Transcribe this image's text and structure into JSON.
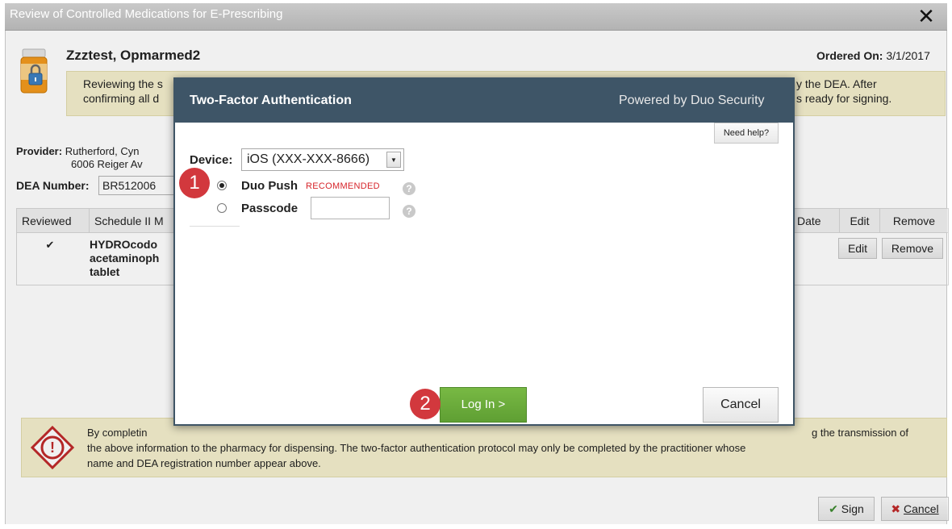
{
  "window": {
    "title": "Review of Controlled Medications for E-Prescribing",
    "close_glyph": "✕"
  },
  "patient": {
    "name": "Zzztest, Opmarmed2",
    "ordered_label": "Ordered On:",
    "ordered_value": "3/1/2017"
  },
  "notice_top": {
    "line1_left": "Reviewing the s",
    "line1_right": "y the DEA. After",
    "line2_left": "confirming all d",
    "line2_right": "s ready for signing."
  },
  "provider": {
    "label": "Provider:",
    "name": "Rutherford, Cyn",
    "address": "6006 Reiger Av",
    "dea_label": "DEA Number:",
    "dea_value": "BR512006"
  },
  "table": {
    "headers": {
      "reviewed": "Reviewed",
      "schedule": "Schedule II M",
      "date": "Date",
      "edit": "Edit",
      "remove": "Remove"
    },
    "row": {
      "check": "✔",
      "med_line1": "HYDROcodo",
      "med_line2": "acetaminoph",
      "med_line3": "tablet",
      "edit_label": "Edit",
      "remove_label": "Remove"
    }
  },
  "notice_bottom": {
    "line1_left": "By completin",
    "line1_right": "g the transmission of",
    "line2": "the above information to the pharmacy for dispensing. The two-factor authentication protocol may only be completed by the practitioner whose",
    "line3": "name and DEA registration number appear above.",
    "warning_glyph": "!"
  },
  "footer": {
    "sign_label": "Sign",
    "cancel_label": "Cancel",
    "sign_glyph": "✔",
    "cancel_glyph": "✖"
  },
  "modal": {
    "title": "Two-Factor Authentication",
    "powered": "Powered by Duo Security",
    "need_help": "Need help?",
    "device_label": "Device:",
    "device_value": "iOS (XXX-XXX-8666)",
    "options": [
      {
        "label": "Duo Push",
        "tag": "RECOMMENDED",
        "selected": true
      },
      {
        "label": "Passcode",
        "selected": false
      }
    ],
    "passcode_value": "",
    "help_glyph": "?",
    "login_label": "Log In >",
    "cancel_label": "Cancel"
  },
  "annotations": {
    "badge1": "1",
    "badge2": "2"
  },
  "colors": {
    "modal_header": "#3e5567",
    "login_button": "#6aaa3e",
    "recommended_text": "#d6242a",
    "badge": "#d2383d",
    "notice_bg": "#f4efcc"
  }
}
